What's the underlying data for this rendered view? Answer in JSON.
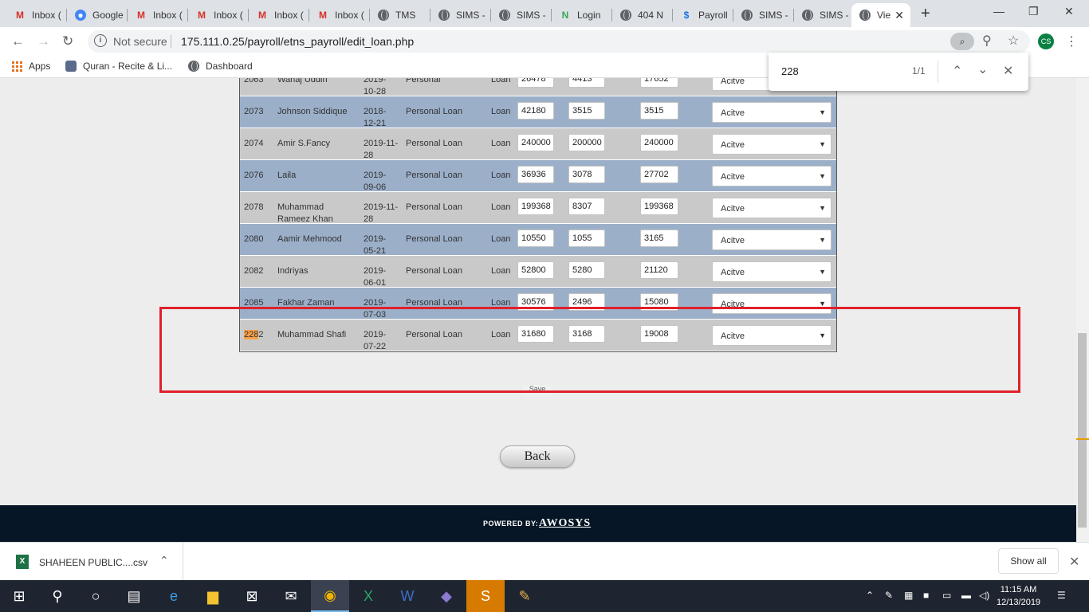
{
  "tabs": [
    {
      "title": "Inbox (",
      "icon": "gmail-icon"
    },
    {
      "title": "Google",
      "icon": "google-account-icon"
    },
    {
      "title": "Inbox (",
      "icon": "gmail-icon"
    },
    {
      "title": "Inbox (",
      "icon": "gmail-icon"
    },
    {
      "title": "Inbox (",
      "icon": "gmail-icon"
    },
    {
      "title": "Inbox (",
      "icon": "gmail-icon"
    },
    {
      "title": "TMS",
      "icon": "globe-icon"
    },
    {
      "title": "SIMS -",
      "icon": "globe-icon"
    },
    {
      "title": "SIMS -",
      "icon": "globe-icon"
    },
    {
      "title": "Login",
      "icon": "ncf-icon"
    },
    {
      "title": "404 N",
      "icon": "globe-icon"
    },
    {
      "title": "Payroll",
      "icon": "payroll-icon"
    },
    {
      "title": "SIMS -",
      "icon": "globe-icon"
    },
    {
      "title": "SIMS -",
      "icon": "globe-icon"
    },
    {
      "title": "Vie",
      "icon": "globe-icon"
    }
  ],
  "addressbar": {
    "security": "Not secure",
    "url": "175.111.0.25/payroll/etns_payroll/edit_loan.php"
  },
  "bookmarks": [
    {
      "label": "Apps"
    },
    {
      "label": "Quran - Recite & Li..."
    },
    {
      "label": "Dashboard"
    }
  ],
  "findbar": {
    "query": "228",
    "count": "1/1"
  },
  "rows": [
    {
      "id": "2063",
      "name": "Wahaj Uddin",
      "date": "2019-10-28",
      "type": "Personal",
      "kind": "Loan",
      "amount": "26478",
      "installment": "4413",
      "balance": "17652",
      "status": "Acitve"
    },
    {
      "id": "2073",
      "name": "Johnson Siddique",
      "date": "2018-12-21",
      "type": "Personal Loan",
      "kind": "Loan",
      "amount": "42180",
      "installment": "3515",
      "balance": "3515",
      "status": "Acitve"
    },
    {
      "id": "2074",
      "name": "Amir S.Fancy",
      "date": "2019-11-28",
      "type": "Personal Loan",
      "kind": "Loan",
      "amount": "240000",
      "installment": "200000",
      "balance": "240000",
      "status": "Acitve"
    },
    {
      "id": "2076",
      "name": "Laila",
      "date": "2019-09-06",
      "type": "Personal Loan",
      "kind": "Loan",
      "amount": "36936",
      "installment": "3078",
      "balance": "27702",
      "status": "Acitve"
    },
    {
      "id": "2078",
      "name": "Muhammad Rameez Khan",
      "date": "2019-11-28",
      "type": "Personal Loan",
      "kind": "Loan",
      "amount": "199368",
      "installment": "8307",
      "balance": "199368",
      "status": "Acitve"
    },
    {
      "id": "2080",
      "name": "Aamir Mehmood",
      "date": "2019-05-21",
      "type": "Personal Loan",
      "kind": "Loan",
      "amount": "10550",
      "installment": "1055",
      "balance": "3165",
      "status": "Acitve"
    },
    {
      "id": "2082",
      "name": "Indriyas",
      "date": "2019-06-01",
      "type": "Personal Loan",
      "kind": "Loan",
      "amount": "52800",
      "installment": "5280",
      "balance": "21120",
      "status": "Acitve"
    },
    {
      "id": "2085",
      "name": "Fakhar Zaman",
      "date": "2019-07-03",
      "type": "Personal Loan",
      "kind": "Loan",
      "amount": "30576",
      "installment": "2496",
      "balance": "15080",
      "status": "Acitve"
    }
  ],
  "highlight_row": {
    "id_match": "228",
    "id_rest": "2",
    "name": "Muhammad Shafi",
    "date": "2019-07-22",
    "type": "Personal Loan",
    "kind": "Loan",
    "amount": "31680",
    "installment": "3168",
    "balance": "19008",
    "status": "Acitve"
  },
  "buttons": {
    "save": "Save",
    "back": "Back"
  },
  "footer": {
    "powered": "POWERED BY:",
    "brand": "AWOSYS"
  },
  "downloads": {
    "file": "SHAHEEN PUBLIC....csv",
    "show_all": "Show all"
  },
  "clock": {
    "time": "11:15 AM",
    "date": "12/13/2019"
  },
  "colors": {
    "row_alt": "#9bafc9",
    "row_plain": "#c9c9c9",
    "footer_bg": "#071626",
    "highlight_box": "#e0202b",
    "find_match": "#f9a04a"
  }
}
